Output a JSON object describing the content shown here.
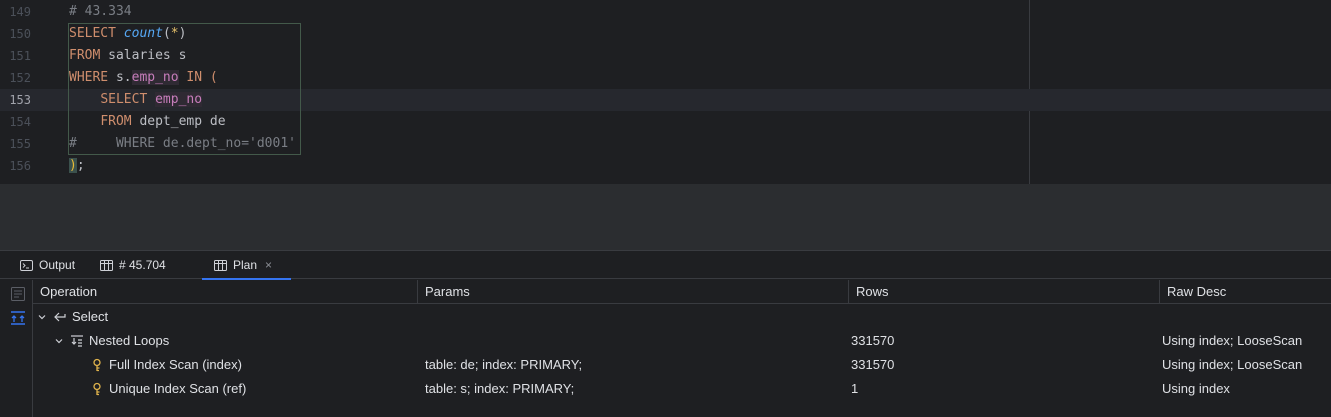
{
  "editor": {
    "lines": [
      {
        "num": "149",
        "text": "# 43.334"
      },
      {
        "num": "150",
        "kw1": "SELECT",
        "fn": "count",
        "p1": "(",
        "star": "*",
        "p2": ")"
      },
      {
        "num": "151",
        "kw1": "FROM",
        "rest": "salaries s"
      },
      {
        "num": "152",
        "kw1": "WHERE",
        "pre": "s.",
        "col": "emp_no",
        "kw2": "IN",
        "brace": "("
      },
      {
        "num": "153",
        "kw1": "SELECT",
        "col": "emp_no"
      },
      {
        "num": "154",
        "kw1": "FROM",
        "rest": "dept_emp de"
      },
      {
        "num": "155",
        "hash": "#",
        "comment": "WHERE de.dept_no='d001'"
      },
      {
        "num": "156",
        "brace": ")",
        "semi": ";"
      }
    ]
  },
  "toolwindow": {
    "tabs": [
      {
        "label": "Output",
        "icon": "console-icon"
      },
      {
        "label": "# 45.704",
        "icon": "table-icon"
      },
      {
        "label": "Plan",
        "icon": "table-icon",
        "active": true,
        "close": "×"
      }
    ],
    "columns": [
      "Operation",
      "Params",
      "Rows",
      "Raw Desc"
    ],
    "rows": [
      {
        "operation": "Select",
        "params": "",
        "rows": "",
        "raw_desc": "",
        "level": 0,
        "icon": "arrow-left-icon"
      },
      {
        "operation": "Nested Loops",
        "params": "",
        "rows": "331570",
        "raw_desc": "Using index; LooseScan",
        "level": 1,
        "icon": "nested-loops-icon"
      },
      {
        "operation": "Full Index Scan (index)",
        "params": "table: de; index: PRIMARY;",
        "rows": "331570",
        "raw_desc": "Using index; LooseScan",
        "level": 2,
        "icon": "key-icon"
      },
      {
        "operation": "Unique Index Scan (ref)",
        "params": "table: s; index: PRIMARY;",
        "rows": "1",
        "raw_desc": "Using index",
        "level": 2,
        "icon": "key-icon"
      }
    ]
  },
  "colors": {
    "accent": "#3574f0",
    "keyword": "#cf8e6d",
    "function": "#56a8f5",
    "column": "#c77dbb",
    "comment": "#7a7e85",
    "key": "#e0b34c"
  }
}
